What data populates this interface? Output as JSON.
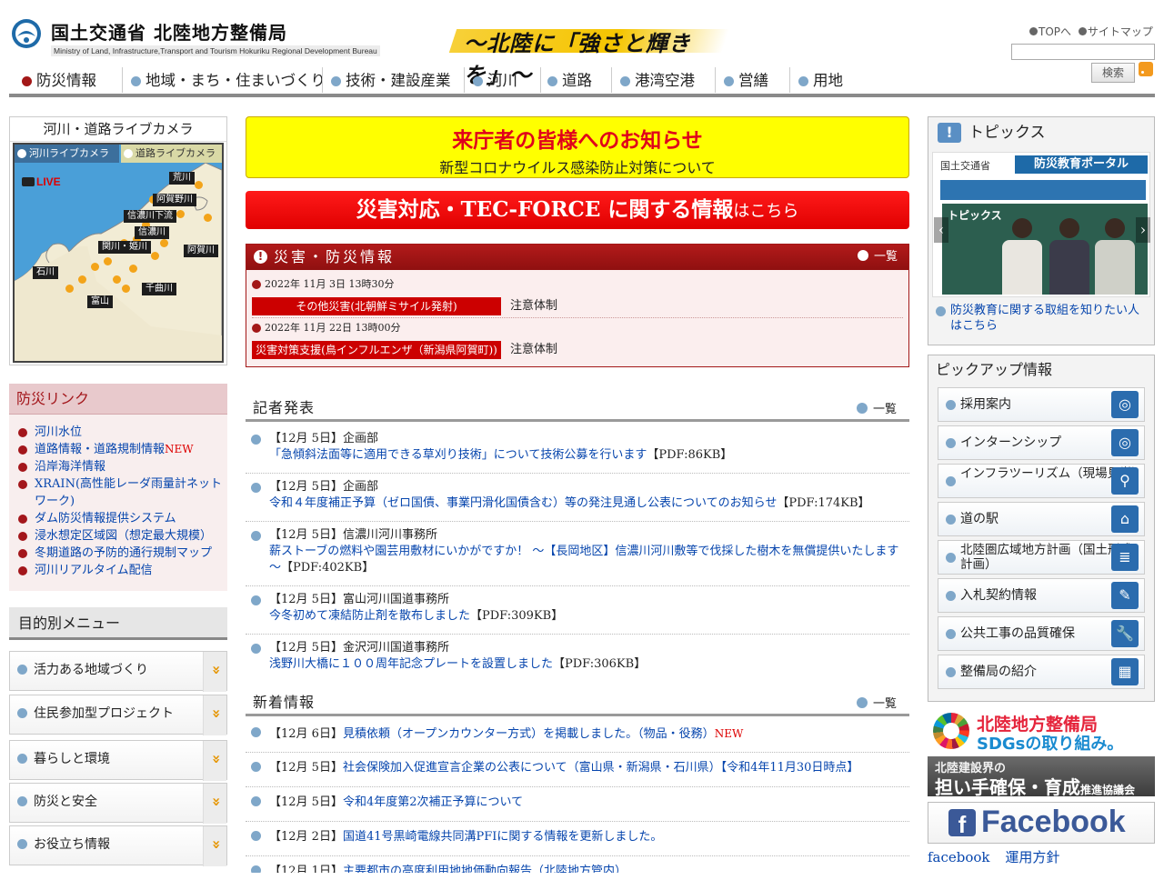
{
  "header": {
    "agency_title": "国土交通省 北陸地方整備局",
    "agency_title_en": "Ministry of Land, Infrastructure,Transport and Tourism Hokuriku Regional Development Bureau",
    "catchphrase": "〜北陸に「強さと輝きを」〜",
    "top_link": "TOPへ",
    "sitemap_link": "サイトマップ",
    "search_value": "",
    "search_button": "検索"
  },
  "nav": {
    "items": [
      {
        "label": "防災情報"
      },
      {
        "label": "地域・まち・住まいづくり"
      },
      {
        "label": "技術・建設産業"
      },
      {
        "label": "河川"
      },
      {
        "label": "道路"
      },
      {
        "label": "港湾空港"
      },
      {
        "label": "営繕"
      },
      {
        "label": "用地"
      }
    ]
  },
  "camera": {
    "title": "河川・道路ライブカメラ",
    "tab_river": "河川ライブカメラ",
    "tab_road": "道路ライブカメラ",
    "live": "LIVE",
    "labels": [
      "荒川",
      "阿賀野川",
      "信濃川下流",
      "信濃川",
      "関川・姫川",
      "阿賀川",
      "石川",
      "富山",
      "千曲川"
    ]
  },
  "bousai_links": {
    "title": "防災リンク",
    "items": [
      {
        "label": "河川水位",
        "new": ""
      },
      {
        "label": "道路情報・道路規制情報",
        "new": "NEW"
      },
      {
        "label": "沿岸海洋情報",
        "new": ""
      },
      {
        "label": "XRAIN(高性能レーダ雨量計ネットワーク)",
        "new": ""
      },
      {
        "label": "ダム防災情報提供システム",
        "new": ""
      },
      {
        "label": "浸水想定区域図（想定最大規模）",
        "new": ""
      },
      {
        "label": "冬期道路の予防的通行規制マップ",
        "new": ""
      },
      {
        "label": "河川リアルタイム配信",
        "new": ""
      }
    ]
  },
  "purpose_menu": {
    "title": "目的別メニュー",
    "items": [
      {
        "label": "活力ある地域づくり"
      },
      {
        "label": "住民参加型プロジェクト"
      },
      {
        "label": "暮らしと環境"
      },
      {
        "label": "防災と安全"
      },
      {
        "label": "お役立ち情報"
      }
    ]
  },
  "notice": {
    "title": "来庁者の皆様へのお知らせ",
    "subtitle": "新型コロナウイルス感染防止対策について"
  },
  "tecforce": {
    "main": "災害対応・TEC-FORCE に関する情報",
    "suffix": "はこちら"
  },
  "disaster": {
    "title": "災害・防災情報",
    "more": "一覧",
    "entries": [
      {
        "date": "2022年 11月 3日 13時30分",
        "type": "その他災害(北朝鮮ミサイル発射)",
        "status": "注意体制"
      },
      {
        "date": "2022年 11月 22日 13時00分",
        "type": "災害対策支援(鳥インフルエンザ（新潟県阿賀町))",
        "status": "注意体制"
      }
    ]
  },
  "press": {
    "title": "記者発表",
    "more": "一覧",
    "items": [
      {
        "meta": "【12月 5日】企画部",
        "title": "「急傾斜法面等に適用できる草刈り技術」について技術公募を行います",
        "pdf": "【PDF:86KB】"
      },
      {
        "meta": "【12月 5日】企画部",
        "title": "令和４年度補正予算（ゼロ国債、事業円滑化国債含む）等の発注見通し公表についてのお知らせ",
        "pdf": "【PDF:174KB】"
      },
      {
        "meta": "【12月 5日】信濃川河川事務所",
        "title": "薪ストーブの燃料や園芸用敷材にいかがですか！ ～【長岡地区】信濃川河川敷等で伐採した樹木を無償提供いたします～",
        "pdf": "【PDF:402KB】"
      },
      {
        "meta": "【12月 5日】富山河川国道事務所",
        "title": "今冬初めて凍結防止剤を散布しました",
        "pdf": "【PDF:309KB】"
      },
      {
        "meta": "【12月 5日】金沢河川国道事務所",
        "title": "浅野川大橋に１００周年記念プレートを設置しました",
        "pdf": "【PDF:306KB】"
      }
    ]
  },
  "news": {
    "title": "新着情報",
    "more": "一覧",
    "items": [
      {
        "date": "【12月 6日】",
        "title": "見積依頼（オープンカウンター方式）を掲載しました。（物品・役務）",
        "new": "NEW"
      },
      {
        "date": "【12月 5日】",
        "title": "社会保険加入促進宣言企業の公表について（富山県・新潟県・石川県）【令和4年11月30日時点】",
        "new": ""
      },
      {
        "date": "【12月 5日】",
        "title": "令和4年度第2次補正予算について",
        "new": ""
      },
      {
        "date": "【12月 2日】",
        "title": "国道41号黒崎電線共同溝PFIに関する情報を更新しました。",
        "new": ""
      },
      {
        "date": "【12月 1日】",
        "title": "主要都市の高度利用地地価動向報告（北陸地方管内）",
        "new": ""
      }
    ]
  },
  "topics": {
    "title": "トピックス",
    "banner_org": "国土交通省",
    "banner_portal": "防災教育ポータル",
    "banner_label": "トピックス",
    "caption": "防災教育に関する取組を知りたい人はこちら"
  },
  "pickup": {
    "title": "ピックアップ情報",
    "items": [
      {
        "label": "採用案内"
      },
      {
        "label": "インターンシップ"
      },
      {
        "label": "インフラツーリズム（現場見学）"
      },
      {
        "label": "道の駅"
      },
      {
        "label": "北陸圏広域地方計画（国土形成計画）"
      },
      {
        "label": "入札契約情報"
      },
      {
        "label": "公共工事の品質確保"
      },
      {
        "label": "整備局の紹介"
      }
    ]
  },
  "banners": {
    "sdgs_line1": "北陸地方整備局",
    "sdgs_line2": "SDGsの取り組み。",
    "ninaite_line1": "北陸建設界の",
    "ninaite_line2": "担い手確保・育成",
    "ninaite_suffix": "推進協議会",
    "facebook": "Facebook",
    "facebook_link": "facebook",
    "policy_link": "運用方針"
  },
  "colors": {
    "accent_red": "#a31818",
    "notice_yellow": "#ffff00",
    "link_blue": "#0645ad",
    "nav_dot_blue": "#7fa7c9"
  }
}
